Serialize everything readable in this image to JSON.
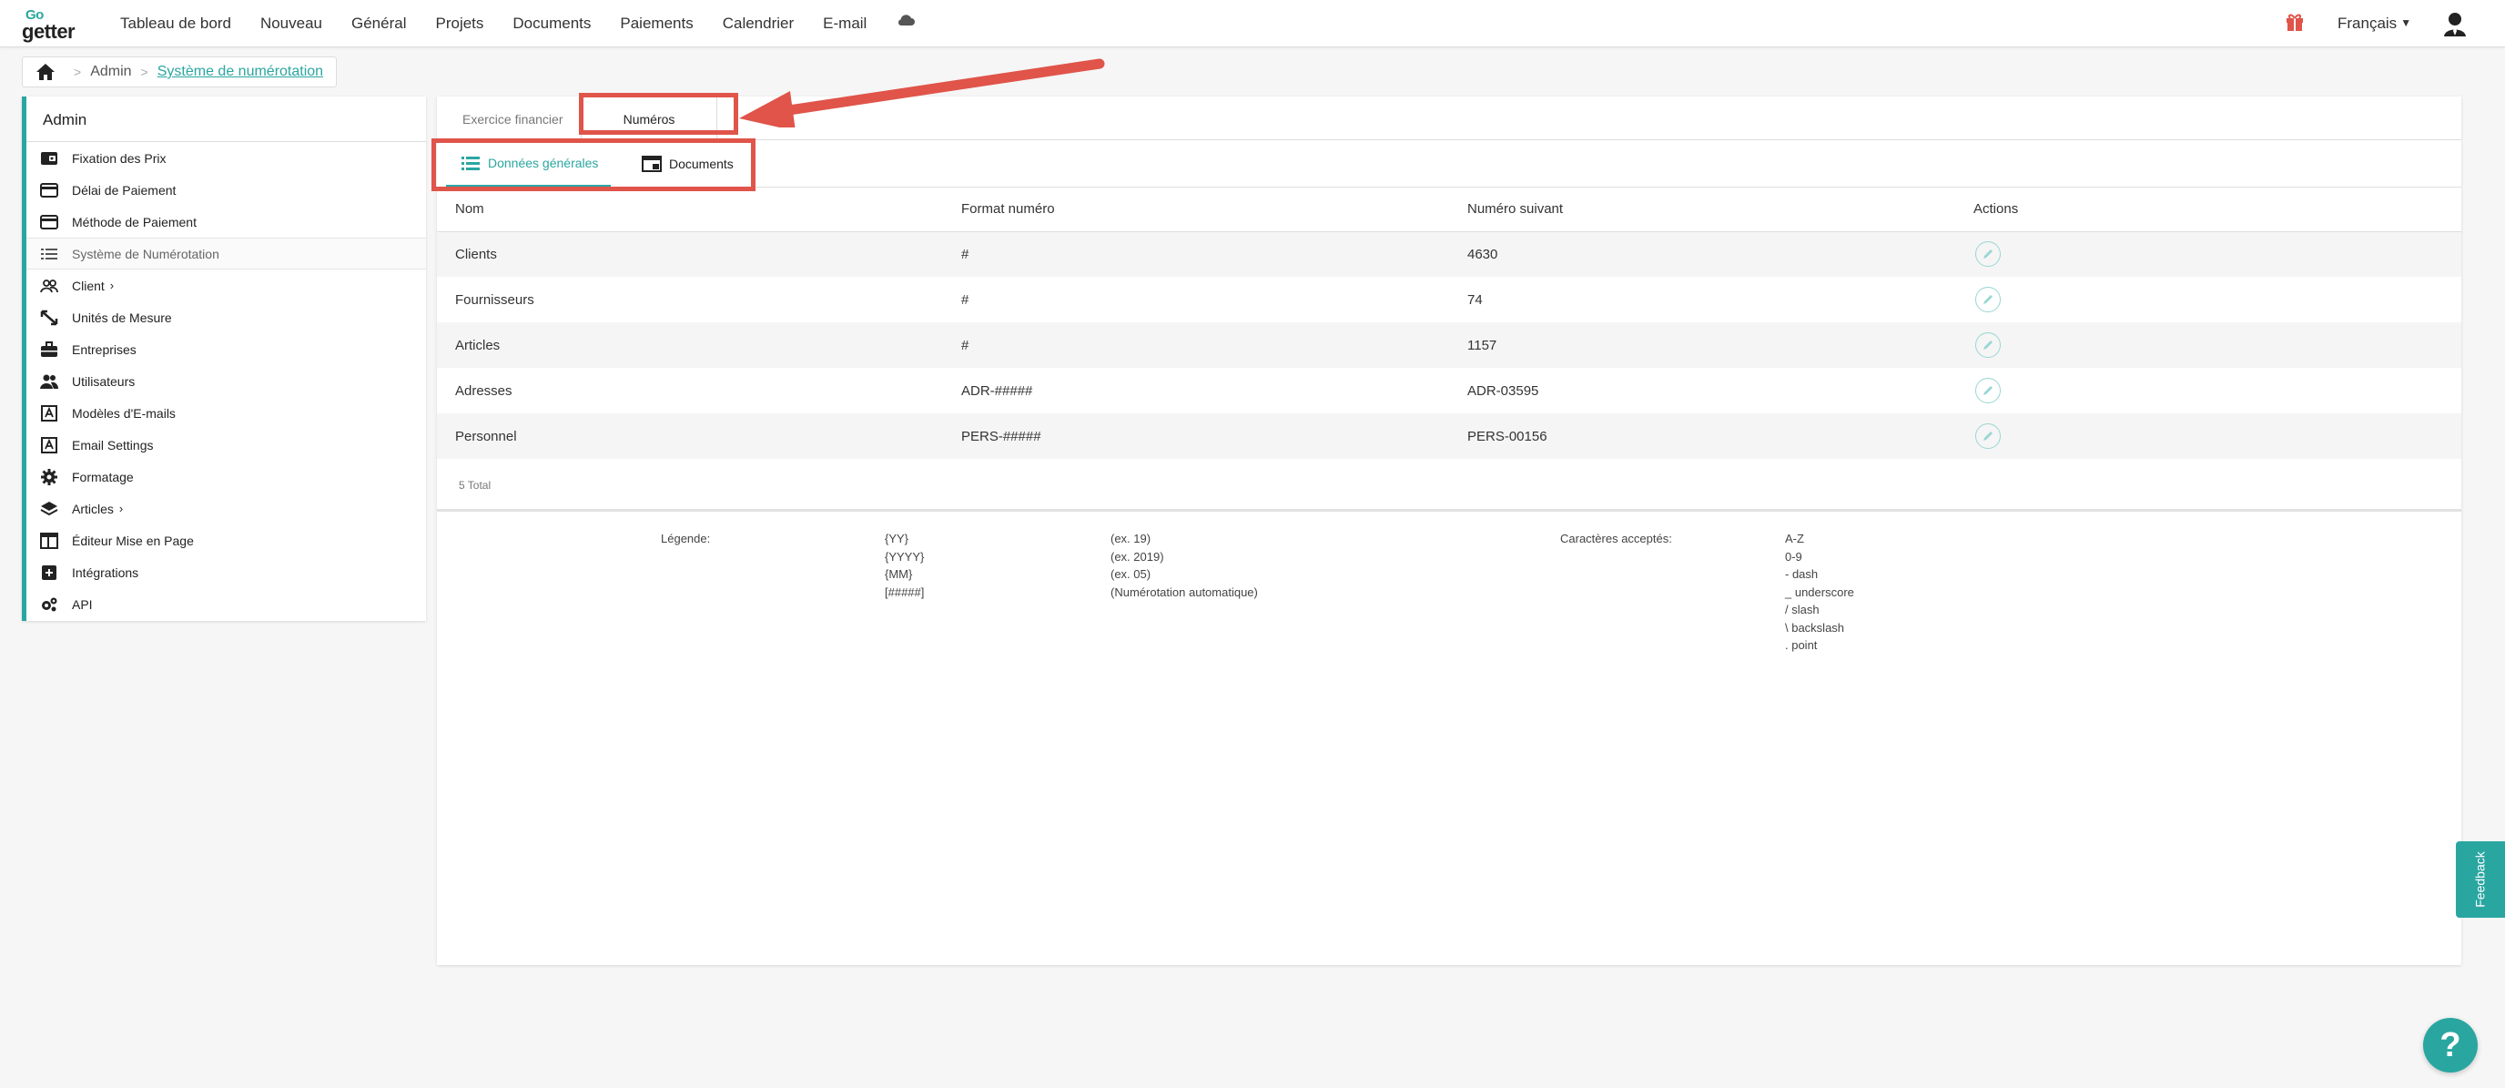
{
  "app": {
    "logo_top": "Go",
    "logo_bottom": "getter"
  },
  "nav": {
    "links": [
      "Tableau de bord",
      "Nouveau",
      "Général",
      "Projets",
      "Documents",
      "Paiements",
      "Calendrier",
      "E-mail"
    ],
    "language": "Français"
  },
  "breadcrumb": {
    "items": [
      "Admin",
      "Système de numérotation"
    ]
  },
  "sidebar": {
    "title": "Admin",
    "items": [
      {
        "label": "Fixation des Prix",
        "icon": "price-tag-icon"
      },
      {
        "label": "Délai de Paiement",
        "icon": "credit-card-icon"
      },
      {
        "label": "Méthode de Paiement",
        "icon": "credit-card-icon"
      },
      {
        "label": "Système de Numérotation",
        "icon": "list-icon"
      },
      {
        "label": "Client",
        "icon": "users-icon"
      },
      {
        "label": "Unités de Mesure",
        "icon": "ruler-icon"
      },
      {
        "label": "Entreprises",
        "icon": "briefcase-icon"
      },
      {
        "label": "Utilisateurs",
        "icon": "people-icon"
      },
      {
        "label": "Modèles d'E-mails",
        "icon": "email-template-icon"
      },
      {
        "label": "Email Settings",
        "icon": "email-settings-icon"
      },
      {
        "label": "Formatage",
        "icon": "gear-icon"
      },
      {
        "label": "Articles",
        "icon": "layers-icon"
      },
      {
        "label": "Éditeur Mise en Page",
        "icon": "layout-icon"
      },
      {
        "label": "Intégrations",
        "icon": "plus-box-icon"
      },
      {
        "label": "API",
        "icon": "gears-icon"
      }
    ]
  },
  "tabs": {
    "fiscal": "Exercice financier",
    "numbers": "Numéros"
  },
  "subtabs": {
    "general": "Données générales",
    "documents": "Documents"
  },
  "table": {
    "columns": [
      "Nom",
      "Format numéro",
      "Numéro suivant",
      "Actions"
    ],
    "rows": [
      [
        "Clients",
        "#",
        "4630"
      ],
      [
        "Fournisseurs",
        "#",
        "74"
      ],
      [
        "Articles",
        "#",
        "1157"
      ],
      [
        "Adresses",
        "ADR-#####",
        "ADR-03595"
      ],
      [
        "Personnel",
        "PERS-#####",
        "PERS-00156"
      ]
    ],
    "total": "5 Total"
  },
  "legend": {
    "label": "Légende:",
    "tokens": [
      "{YY}",
      "{YYYY}",
      "{MM}",
      "[#####]"
    ],
    "examples": [
      "(ex. 19)",
      "(ex. 2019)",
      "(ex. 05)",
      "(Numérotation automatique)"
    ],
    "accepted_label": "Caractères acceptés:",
    "accepted": [
      "A-Z",
      "0-9",
      "- dash",
      "_ underscore",
      "/ slash",
      "\\ backslash",
      ". point"
    ]
  },
  "feedback": "Feedback",
  "help": "?",
  "colors": {
    "accent": "#2aa6a1",
    "highlight": "#e0544a"
  }
}
